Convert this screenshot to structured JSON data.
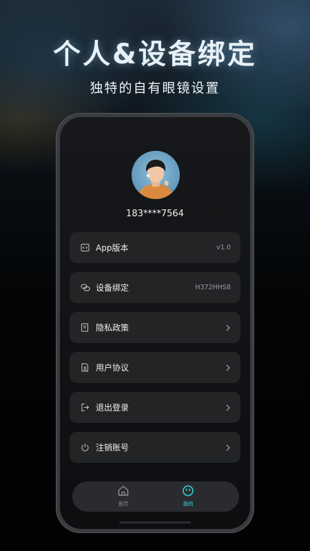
{
  "headline": "个人&设备绑定",
  "subline": "独特的自有眼镜设置",
  "profile": {
    "phone_masked": "183****7564"
  },
  "menu": [
    {
      "label": "App版本",
      "value": "v1.0",
      "icon": "code-window-icon"
    },
    {
      "label": "设备绑定",
      "value": "H372HHS8",
      "icon": "link-icon"
    },
    {
      "label": "隐私政策",
      "value": "",
      "icon": "document-icon"
    },
    {
      "label": "用户协议",
      "value": "",
      "icon": "user-document-icon"
    },
    {
      "label": "退出登录",
      "value": "",
      "icon": "logout-icon"
    },
    {
      "label": "注销账号",
      "value": "",
      "icon": "power-icon"
    }
  ],
  "tabbar": {
    "home_label": "首页",
    "mine_label": "我的",
    "active": "mine",
    "active_color": "#2fd3d8",
    "inactive_color": "#8d8f93"
  }
}
